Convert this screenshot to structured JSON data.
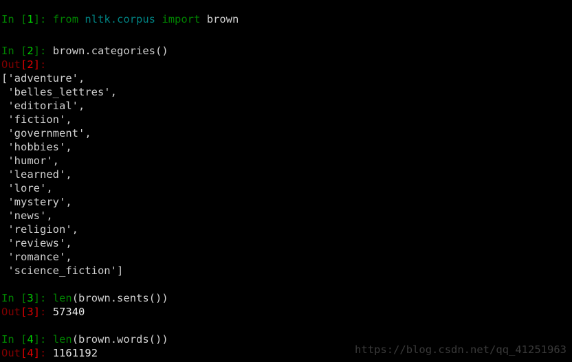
{
  "terminal": {
    "background_color": "#000000",
    "foreground_color": "#d0d0d0",
    "prompt_in_color": "#008000",
    "prompt_out_color": "#800000",
    "keyword_color": "#008000",
    "module_color": "#008080",
    "watermark_color": "#3a3a3a"
  },
  "cells": [
    {
      "in_label": "In ",
      "in_open": "[",
      "in_number": "1",
      "in_close": "]",
      "in_colon": ": ",
      "code_keyword_from": "from",
      "code_module": " nltk.corpus ",
      "code_keyword_import": "import",
      "code_name": " brown"
    },
    {
      "in_label": "In ",
      "in_open": "[",
      "in_number": "2",
      "in_close": "]",
      "in_colon": ": ",
      "code": "brown.categories()",
      "out_label": "Out",
      "out_open": "[",
      "out_number": "2",
      "out_close": "]",
      "out_colon": ":"
    },
    {
      "in_label": "In ",
      "in_open": "[",
      "in_number": "3",
      "in_close": "]",
      "in_colon": ": ",
      "code_builtin": "len",
      "code_rest": "(brown.sents())",
      "out_label": "Out",
      "out_open": "[",
      "out_number": "3",
      "out_close": "]",
      "out_colon": ": ",
      "out_value": "57340"
    },
    {
      "in_label": "In ",
      "in_open": "[",
      "in_number": "4",
      "in_close": "]",
      "in_colon": ": ",
      "code_builtin": "len",
      "code_rest": "(brown.words())",
      "out_label": "Out",
      "out_open": "[",
      "out_number": "4",
      "out_close": "]",
      "out_colon": ": ",
      "out_value": "1161192"
    }
  ],
  "list_output": {
    "open_bracket": "[",
    "close_bracket": "]",
    "lines": [
      "['adventure',",
      " 'belles_lettres',",
      " 'editorial',",
      " 'fiction',",
      " 'government',",
      " 'hobbies',",
      " 'humor',",
      " 'learned',",
      " 'lore',",
      " 'mystery',",
      " 'news',",
      " 'religion',",
      " 'reviews',",
      " 'romance',",
      " 'science_fiction']"
    ],
    "items": [
      "adventure",
      "belles_lettres",
      "editorial",
      "fiction",
      "government",
      "hobbies",
      "humor",
      "learned",
      "lore",
      "mystery",
      "news",
      "religion",
      "reviews",
      "romance",
      "science_fiction"
    ]
  },
  "watermark": {
    "text": "https://blog.csdn.net/qq_41251963"
  }
}
